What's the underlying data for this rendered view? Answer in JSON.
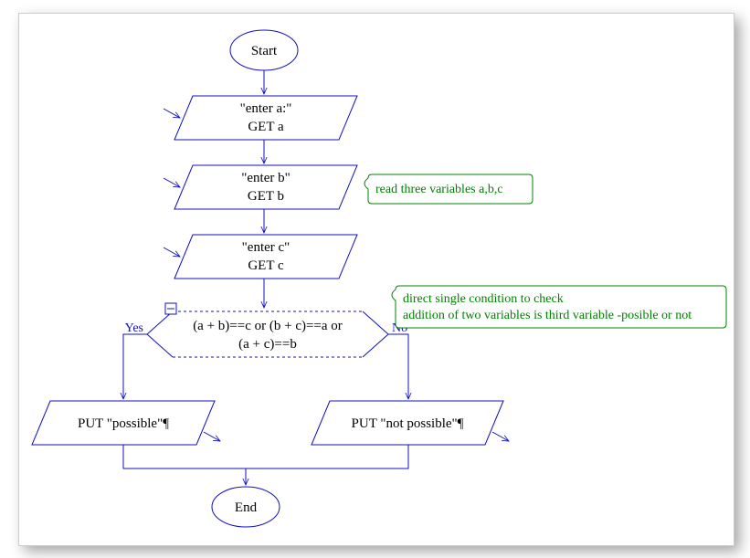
{
  "nodes": {
    "start": "Start",
    "end": "End",
    "ioA1": "\"enter a:\"",
    "ioA2": "GET a",
    "ioB1": "\"enter b\"",
    "ioB2": "GET b",
    "ioC1": "\"enter c\"",
    "ioC2": "GET c",
    "dec1": "(a + b)==c or (b + c)==a or",
    "dec2": "(a + c)==b",
    "outYes": "PUT \"possible\"¶",
    "outNo": "PUT \"not possible\"¶"
  },
  "labels": {
    "yes": "Yes",
    "no": "No"
  },
  "notes": {
    "n1": "read three variables a,b,c",
    "n2a": "direct single condition to check",
    "n2b": "addition of two variables is third variable -posible or not"
  }
}
